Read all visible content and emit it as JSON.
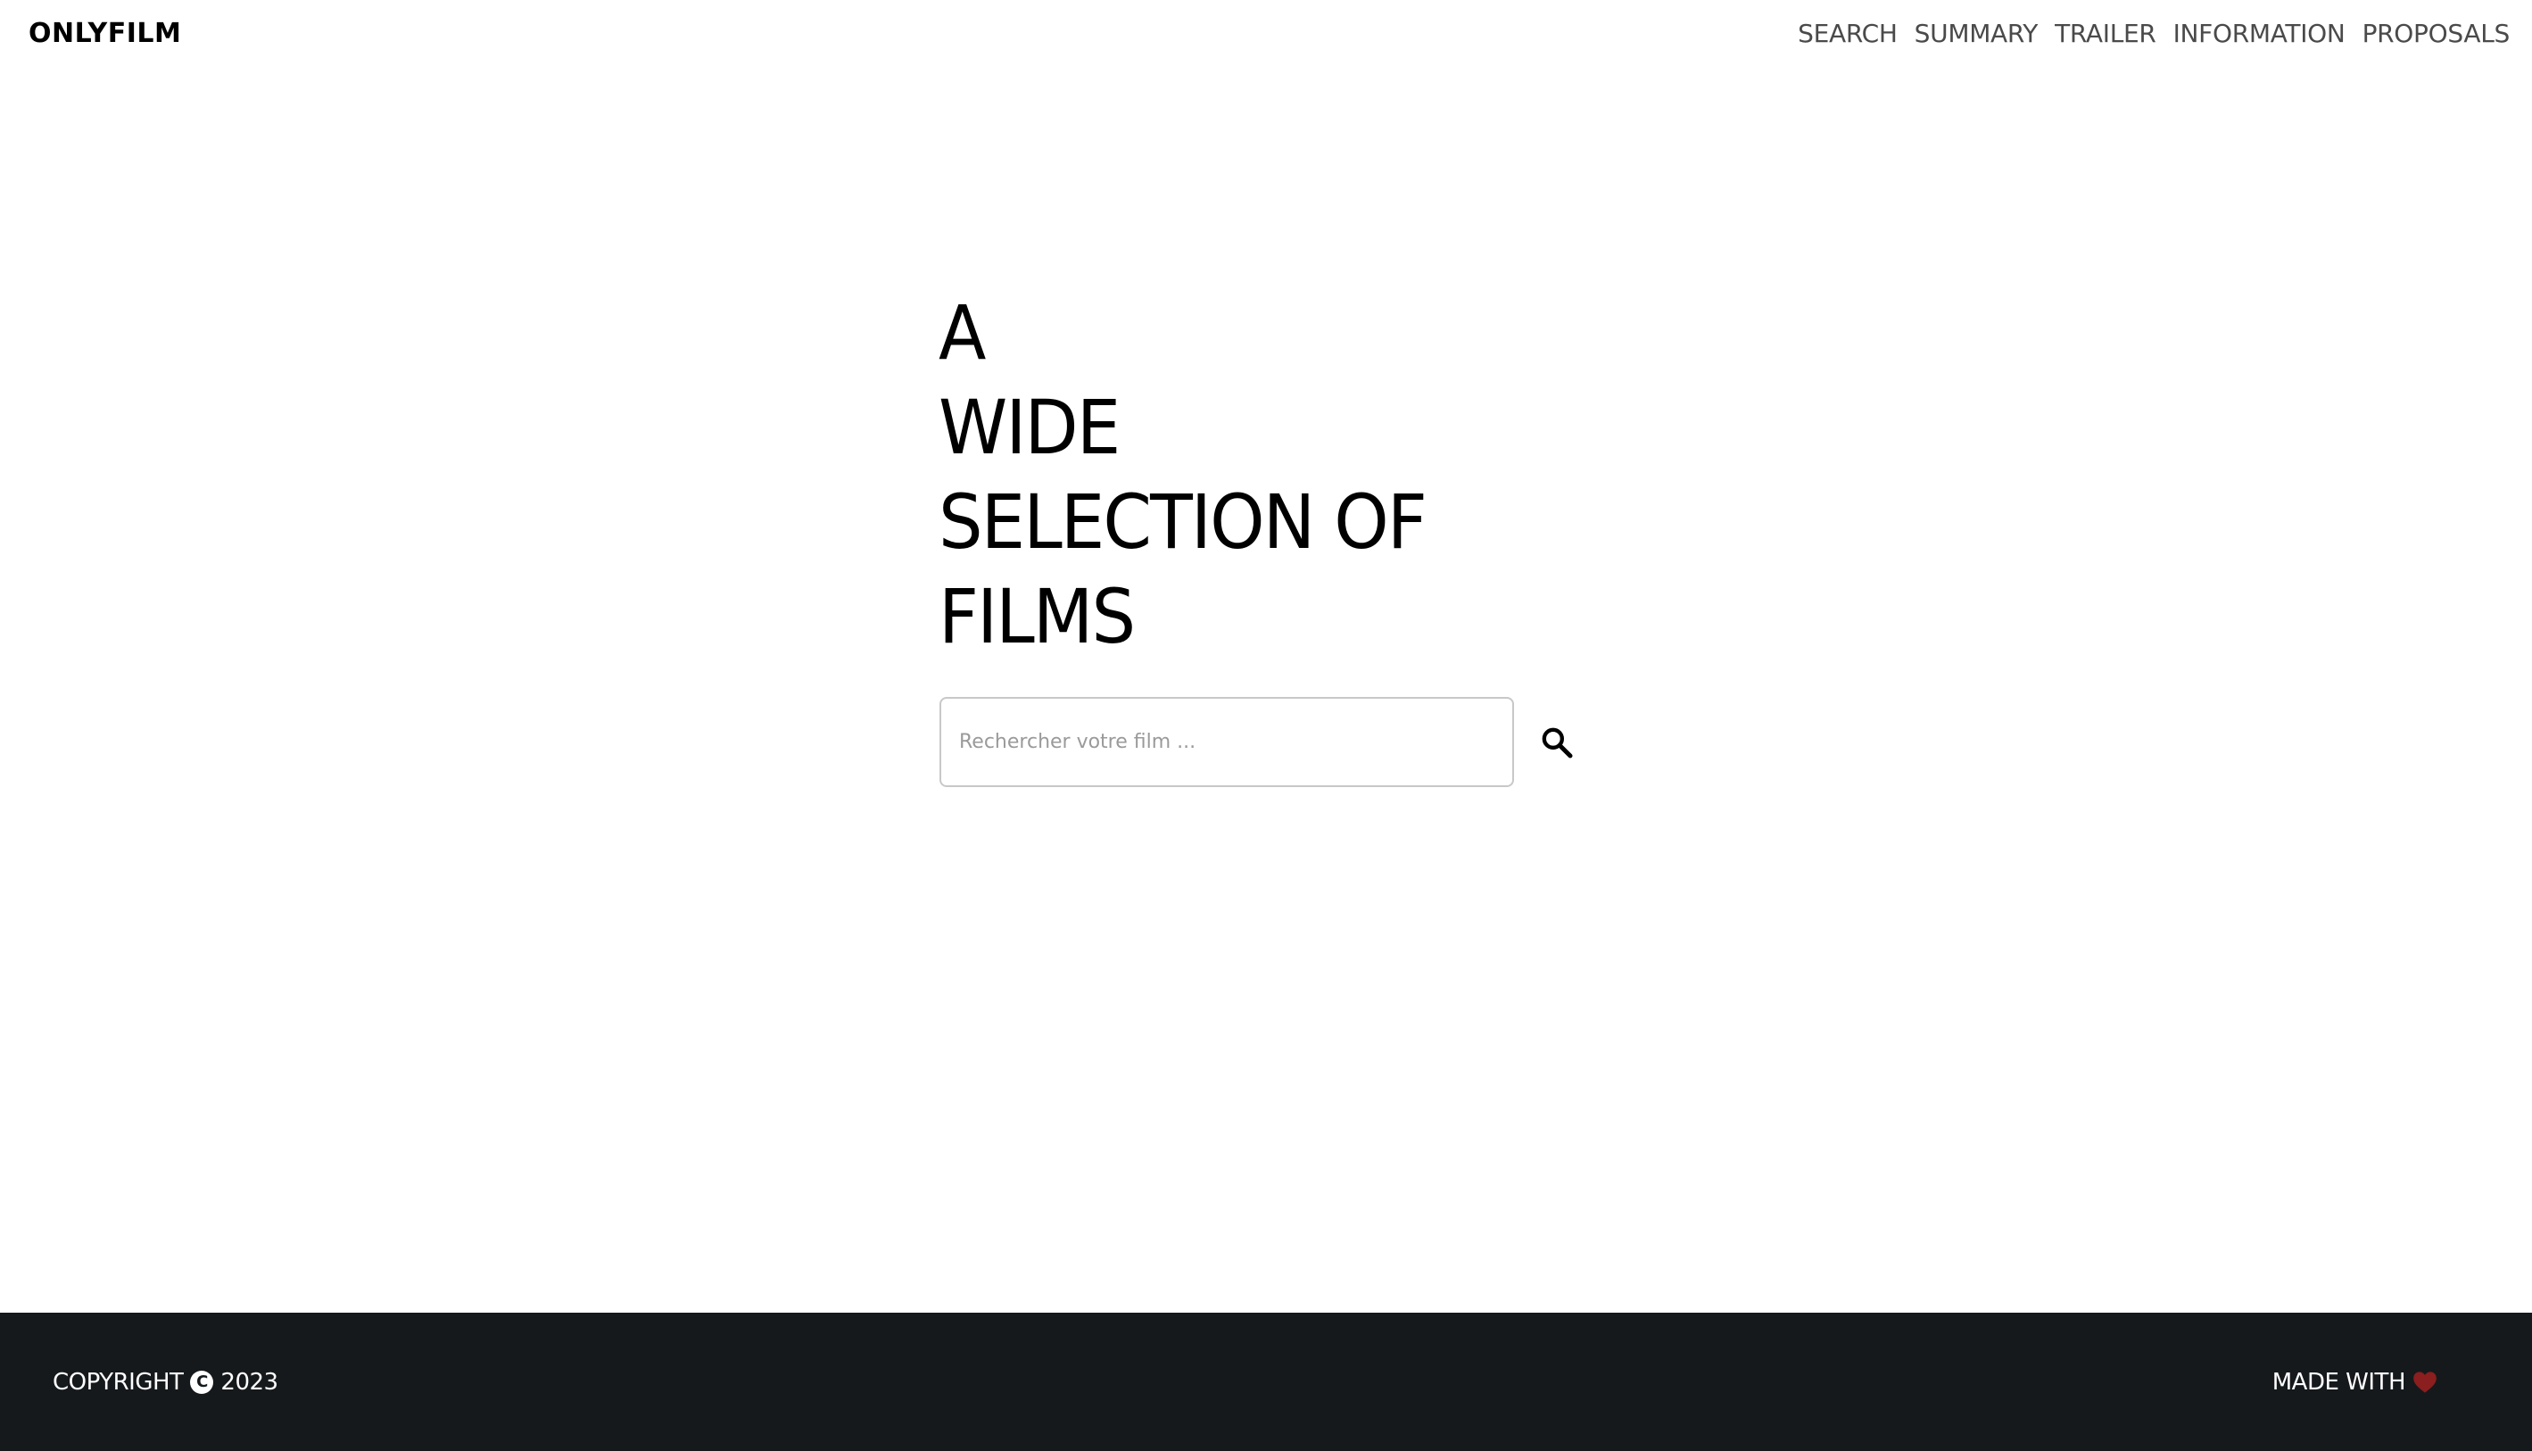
{
  "header": {
    "brand": "ONLYFILM",
    "nav": [
      {
        "label": "SEARCH"
      },
      {
        "label": "SUMMARY"
      },
      {
        "label": "TRAILER"
      },
      {
        "label": "INFORMATION"
      },
      {
        "label": "PROPOSALS"
      }
    ]
  },
  "hero": {
    "title_lines": [
      "A",
      "WIDE",
      "SELECTION OF",
      "FILMS"
    ]
  },
  "search": {
    "value": "",
    "placeholder": "Rechercher votre film ...",
    "button_icon": "search-icon"
  },
  "footer": {
    "copyright_label": "COPYRIGHT",
    "copyright_icon": "copyright-icon",
    "year": "2023",
    "made_with_label": "MADE WITH",
    "heart_icon": "heart-icon"
  },
  "colors": {
    "background": "#ffffff",
    "text": "#000000",
    "nav_text": "#4a4a4a",
    "footer_background": "#15191c",
    "footer_text": "#ffffff",
    "heart": "#8b1e1e",
    "input_border": "#c8c8c8",
    "placeholder": "#9a9a9a"
  }
}
